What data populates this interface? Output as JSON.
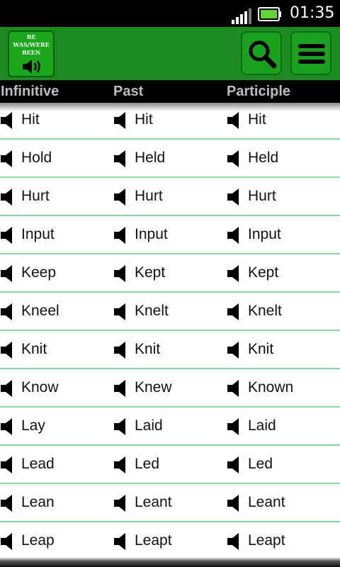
{
  "status_bar": {
    "time": "01:35",
    "signal_icon": "signal-bars-icon",
    "battery_icon": "battery-icon"
  },
  "app_bar": {
    "logo": {
      "line1": "BE",
      "line2": "WAS/WERE",
      "line3": "BEEN",
      "icon": "speaker-icon"
    },
    "search_icon": "search-icon",
    "menu_icon": "menu-icon",
    "accent_color": "#1e8a22"
  },
  "columns": [
    "Infinitive",
    "Past",
    "Participle"
  ],
  "verbs": [
    [
      "Hit",
      "Hit",
      "Hit"
    ],
    [
      "Hold",
      "Held",
      "Held"
    ],
    [
      "Hurt",
      "Hurt",
      "Hurt"
    ],
    [
      "Input",
      "Input",
      "Input"
    ],
    [
      "Keep",
      "Kept",
      "Kept"
    ],
    [
      "Kneel",
      "Knelt",
      "Knelt"
    ],
    [
      "Knit",
      "Knit",
      "Knit"
    ],
    [
      "Know",
      "Knew",
      "Known"
    ],
    [
      "Lay",
      "Laid",
      "Laid"
    ],
    [
      "Lead",
      "Led",
      "Led"
    ],
    [
      "Lean",
      "Leant",
      "Leant"
    ],
    [
      "Leap",
      "Leapt",
      "Leapt"
    ]
  ]
}
